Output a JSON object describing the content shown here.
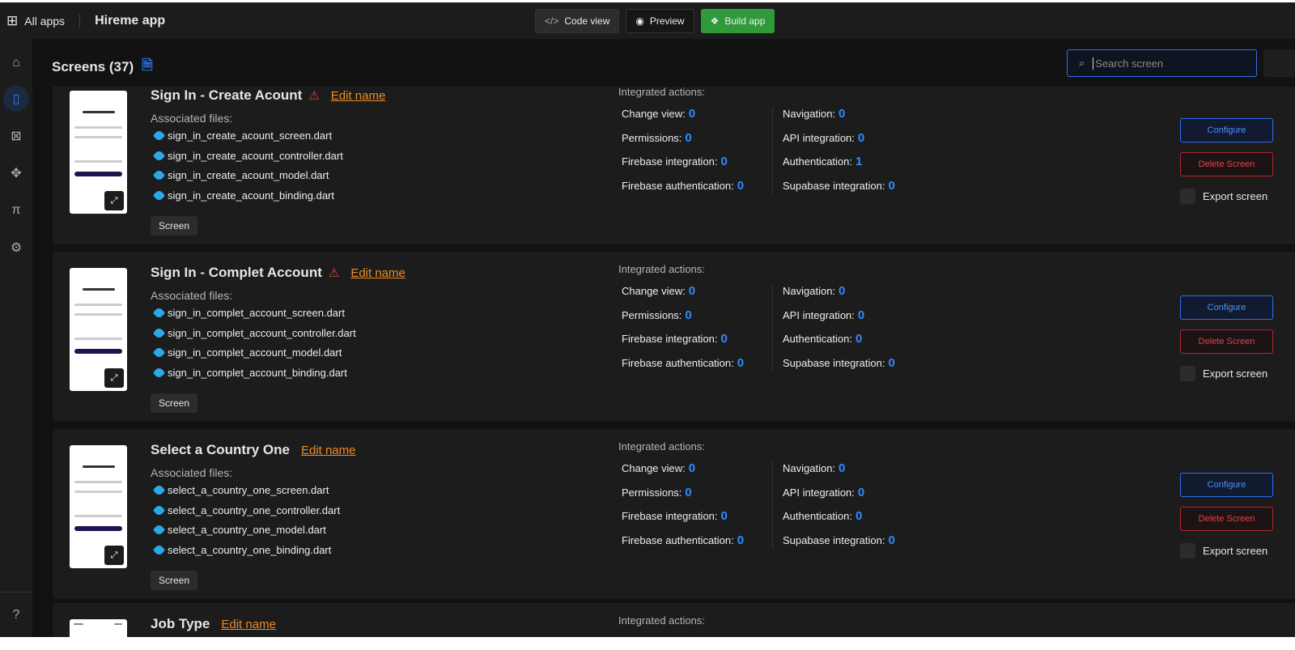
{
  "topbar": {
    "all_apps": "All apps",
    "app_title": "Hireme app",
    "code_view": "Code view",
    "preview": "Preview",
    "build_app": "Build app"
  },
  "header": {
    "title": "Screens (37)",
    "search_placeholder": "Search screen"
  },
  "labels": {
    "associated": "Associated files:",
    "integrated": "Integrated actions:",
    "configure": "Configure",
    "delete": "Delete Screen",
    "export": "Export screen",
    "edit_name": "Edit name",
    "tag": "Screen"
  },
  "action_labels": [
    "Change view:",
    "Permissions:",
    "Firebase integration:",
    "Firebase authentication:",
    "Navigation:",
    "API integration:",
    "Authentication:",
    "Supabase integration:"
  ],
  "screens": [
    {
      "name": "Sign In - Create Acount",
      "warning": true,
      "files": [
        "sign_in_create_acount_screen.dart",
        "sign_in_create_acount_controller.dart",
        "sign_in_create_acount_model.dart",
        "sign_in_create_acount_binding.dart"
      ],
      "actions": [
        0,
        0,
        0,
        0,
        0,
        0,
        1,
        0
      ]
    },
    {
      "name": "Sign In - Complet Account",
      "warning": true,
      "files": [
        "sign_in_complet_account_screen.dart",
        "sign_in_complet_account_controller.dart",
        "sign_in_complet_account_model.dart",
        "sign_in_complet_account_binding.dart"
      ],
      "actions": [
        0,
        0,
        0,
        0,
        0,
        0,
        0,
        0
      ]
    },
    {
      "name": "Select a Country One",
      "warning": false,
      "files": [
        "select_a_country_one_screen.dart",
        "select_a_country_one_controller.dart",
        "select_a_country_one_model.dart",
        "select_a_country_one_binding.dart"
      ],
      "actions": [
        0,
        0,
        0,
        0,
        0,
        0,
        0,
        0
      ]
    },
    {
      "name": "Job Type",
      "warning": false,
      "files": [],
      "actions": []
    }
  ],
  "colors": {
    "accent": "#2d6ff0",
    "build": "#2f9a3a",
    "edit": "#f08a24",
    "danger": "#e0404a"
  }
}
